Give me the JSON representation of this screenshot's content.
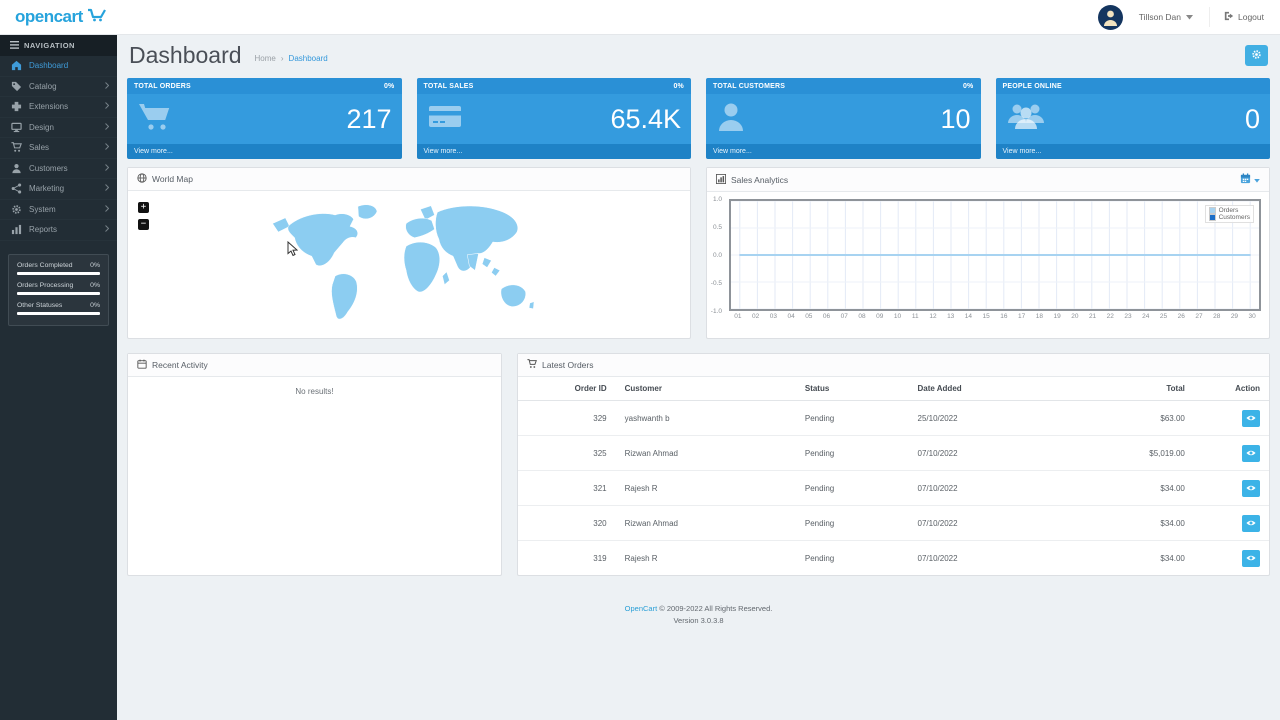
{
  "header": {
    "logo_text": "opencart",
    "user_name": "Tillson Dan",
    "logout_label": "Logout"
  },
  "sidebar": {
    "nav_title": "NAVIGATION",
    "items": [
      {
        "label": "Dashboard",
        "icon": "dashboard-icon",
        "active": true,
        "expandable": false
      },
      {
        "label": "Catalog",
        "icon": "tag-icon",
        "active": false,
        "expandable": true
      },
      {
        "label": "Extensions",
        "icon": "puzzle-icon",
        "active": false,
        "expandable": true
      },
      {
        "label": "Design",
        "icon": "monitor-icon",
        "active": false,
        "expandable": true
      },
      {
        "label": "Sales",
        "icon": "cart-icon",
        "active": false,
        "expandable": true
      },
      {
        "label": "Customers",
        "icon": "user-icon",
        "active": false,
        "expandable": true
      },
      {
        "label": "Marketing",
        "icon": "share-icon",
        "active": false,
        "expandable": true
      },
      {
        "label": "System",
        "icon": "gear-icon",
        "active": false,
        "expandable": true
      },
      {
        "label": "Reports",
        "icon": "bar-chart-icon",
        "active": false,
        "expandable": true
      }
    ],
    "stats": [
      {
        "label": "Orders Completed",
        "value": "0%"
      },
      {
        "label": "Orders Processing",
        "value": "0%"
      },
      {
        "label": "Other Statuses",
        "value": "0%"
      }
    ]
  },
  "page": {
    "title": "Dashboard",
    "breadcrumb_home": "Home",
    "breadcrumb_current": "Dashboard"
  },
  "tiles": [
    {
      "label": "TOTAL ORDERS",
      "percent": "0%",
      "value": "217",
      "icon": "cart-icon",
      "view_more": "View more..."
    },
    {
      "label": "TOTAL SALES",
      "percent": "0%",
      "value": "65.4K",
      "icon": "credit-card-icon",
      "view_more": "View more..."
    },
    {
      "label": "TOTAL CUSTOMERS",
      "percent": "0%",
      "value": "10",
      "icon": "user-icon",
      "view_more": "View more..."
    },
    {
      "label": "PEOPLE ONLINE",
      "percent": "",
      "value": "0",
      "icon": "users-icon",
      "view_more": "View more..."
    }
  ],
  "world_map": {
    "title": "World Map",
    "zoom_in": "+",
    "zoom_out": "−",
    "map_color": "#8ccdf1"
  },
  "sales_analytics": {
    "title": "Sales Analytics"
  },
  "chart_data": {
    "type": "line",
    "title": "Sales Analytics",
    "x": [
      "01",
      "02",
      "03",
      "04",
      "05",
      "06",
      "07",
      "08",
      "09",
      "10",
      "11",
      "12",
      "13",
      "14",
      "15",
      "16",
      "17",
      "18",
      "19",
      "20",
      "21",
      "22",
      "23",
      "24",
      "25",
      "26",
      "27",
      "28",
      "29",
      "30"
    ],
    "series": [
      {
        "name": "Orders",
        "color": "#a7d3f1",
        "values": [
          0,
          0,
          0,
          0,
          0,
          0,
          0,
          0,
          0,
          0,
          0,
          0,
          0,
          0,
          0,
          0,
          0,
          0,
          0,
          0,
          0,
          0,
          0,
          0,
          0,
          0,
          0,
          0,
          0,
          0
        ]
      },
      {
        "name": "Customers",
        "color": "#1c6fc8",
        "values": [
          0,
          0,
          0,
          0,
          0,
          0,
          0,
          0,
          0,
          0,
          0,
          0,
          0,
          0,
          0,
          0,
          0,
          0,
          0,
          0,
          0,
          0,
          0,
          0,
          0,
          0,
          0,
          0,
          0,
          0
        ]
      }
    ],
    "ylim": [
      -1.0,
      1.0
    ],
    "yticks": [
      1.0,
      0.5,
      0.0,
      -0.5,
      -1.0
    ],
    "grid": true,
    "legend_position": "top-right"
  },
  "recent_activity": {
    "title": "Recent Activity",
    "empty_message": "No results!"
  },
  "latest_orders": {
    "title": "Latest Orders",
    "columns": [
      "Order ID",
      "Customer",
      "Status",
      "Date Added",
      "Total",
      "Action"
    ],
    "rows": [
      {
        "order_id": "329",
        "customer": "yashwanth b",
        "status": "Pending",
        "date_added": "25/10/2022",
        "total": "$63.00"
      },
      {
        "order_id": "325",
        "customer": "Rizwan Ahmad",
        "status": "Pending",
        "date_added": "07/10/2022",
        "total": "$5,019.00"
      },
      {
        "order_id": "321",
        "customer": "Rajesh R",
        "status": "Pending",
        "date_added": "07/10/2022",
        "total": "$34.00"
      },
      {
        "order_id": "320",
        "customer": "Rizwan Ahmad",
        "status": "Pending",
        "date_added": "07/10/2022",
        "total": "$34.00"
      },
      {
        "order_id": "319",
        "customer": "Rajesh R",
        "status": "Pending",
        "date_added": "07/10/2022",
        "total": "$34.00"
      }
    ]
  },
  "footer": {
    "link_text": "OpenCart",
    "copyright": "© 2009-2022 All Rights Reserved.",
    "version": "Version 3.0.3.8"
  },
  "colors": {
    "accent_blue": "#3498db",
    "tile_head": "#2a90d6",
    "tile_body": "#349bde",
    "tile_foot": "#1e82c6",
    "sidebar_bg": "#222d35",
    "action_btn": "#3cb3e7"
  }
}
